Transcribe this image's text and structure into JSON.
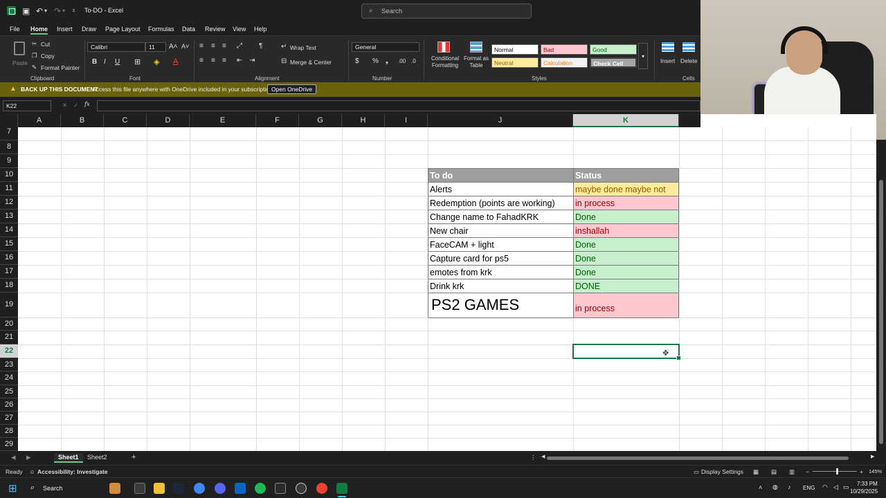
{
  "titlebar": {
    "title": "To-DO  -  Excel",
    "search_placeholder": "Search"
  },
  "menu": {
    "tabs": [
      "File",
      "Home",
      "Insert",
      "Draw",
      "Page Layout",
      "Formulas",
      "Data",
      "Review",
      "View",
      "Help"
    ],
    "active": "Home"
  },
  "ribbon": {
    "clipboard": {
      "paste": "Paste",
      "cut": "Cut",
      "copy": "Copy",
      "format_painter": "Format Painter",
      "label": "Clipboard"
    },
    "font": {
      "name": "Calibri",
      "size": "11",
      "label": "Font"
    },
    "alignment": {
      "wrap": "Wrap Text",
      "merge": "Merge & Center",
      "label": "Alignment"
    },
    "number": {
      "format": "General",
      "label": "Number"
    },
    "styles": {
      "conditional": "Conditional Formatting",
      "format_table": "Format as Table",
      "normal": "Normal",
      "bad": "Bad",
      "good": "Good",
      "neutral": "Neutral",
      "calculation": "Calculation",
      "check_cell": "Check Cell",
      "label": "Styles"
    },
    "cells": {
      "insert": "Insert",
      "delete": "Delete",
      "label": "Cells"
    }
  },
  "banner": {
    "title": "BACK UP THIS DOCUMENT",
    "message": "Access this file anywhere with OneDrive included in your subscription.",
    "button": "Open OneDrive"
  },
  "formula": {
    "namebox": "K22",
    "fx": "fx",
    "value": ""
  },
  "columns": [
    "A",
    "B",
    "C",
    "D",
    "E",
    "F",
    "G",
    "H",
    "I",
    "J",
    "K"
  ],
  "rows": [
    "7",
    "8",
    "9",
    "10",
    "11",
    "12",
    "13",
    "14",
    "15",
    "16",
    "17",
    "18",
    "19",
    "20",
    "21",
    "22",
    "23",
    "24",
    "25",
    "26",
    "27",
    "28",
    "29"
  ],
  "table": {
    "header": {
      "todo": "To do",
      "status": "Status"
    },
    "rows": [
      {
        "todo": "Alerts",
        "status": "maybe done maybe not",
        "kind": "neutral"
      },
      {
        "todo": "Redemption (points are working)",
        "status": "in process",
        "kind": "bad"
      },
      {
        "todo": "Change name to FahadKRK",
        "status": "Done",
        "kind": "good"
      },
      {
        "todo": "New chair",
        "status": "inshallah",
        "kind": "bad"
      },
      {
        "todo": "FaceCAM + light",
        "status": "Done",
        "kind": "good"
      },
      {
        "todo": "Capture card for ps5",
        "status": "Done",
        "kind": "good"
      },
      {
        "todo": "emotes from krk",
        "status": "Done",
        "kind": "good"
      },
      {
        "todo": "Drink krk",
        "status": "DONE",
        "kind": "good"
      },
      {
        "todo": "PS2 GAMES",
        "status": "in process",
        "kind": "bad"
      }
    ]
  },
  "sheets": [
    "Sheet1",
    "Sheet2"
  ],
  "status": {
    "ready": "Ready",
    "accessibility": "Accessibility: Investigate",
    "display": "Display Settings",
    "zoom": "145%"
  },
  "taskbar": {
    "search": "Search",
    "lang": "ENG",
    "time": "7:33 PM",
    "date": "10/29/2025"
  },
  "colors": {
    "excel_green": "#107c41",
    "good_bg": "#c6efce",
    "good_fg": "#006100",
    "bad_bg": "#ffc7ce",
    "bad_fg": "#9c0006",
    "neutral_bg": "#ffeb9c",
    "neutral_fg": "#9c5700",
    "header_bg": "#9e9e9e"
  }
}
